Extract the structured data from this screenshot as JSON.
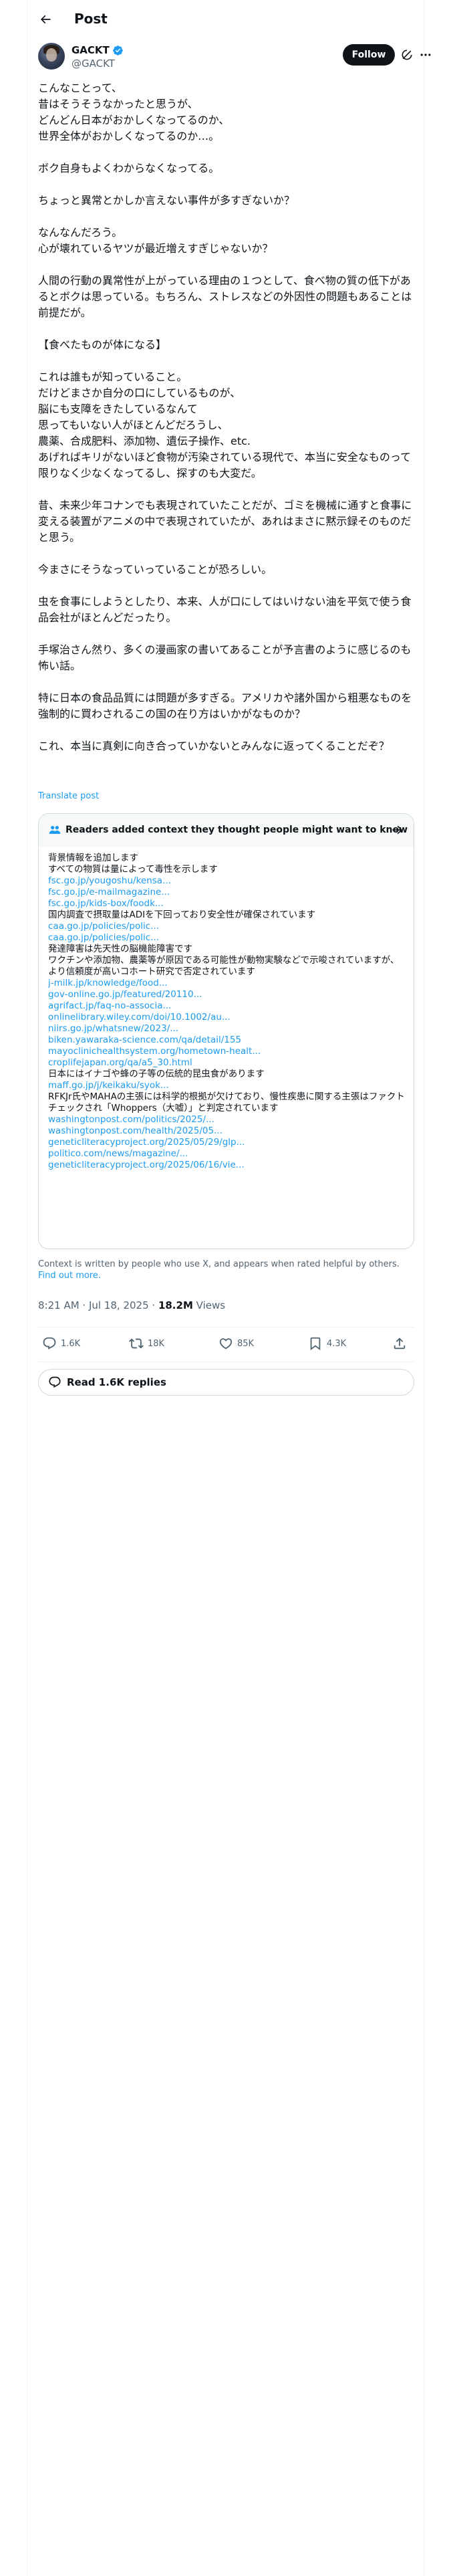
{
  "header": {
    "title": "Post"
  },
  "author": {
    "name": "GACKT",
    "handle": "@GACKT",
    "follow_label": "Follow"
  },
  "tweet": {
    "text": "こんなことって、\n昔はそうそうなかったと思うが、\nどんどん日本がおかしくなってるのか、\n世界全体がおかしくなってるのか…。\n\nボク自身もよくわからなくなってる。\n\nちょっと異常とかしか言えない事件が多すぎないか？\n\nなんなんだろう。\n心が壊れているヤツが最近増えすぎじゃないか？\n\n人間の行動の異常性が上がっている理由の１つとして、食べ物の質の低下があるとボクは思っている。もちろん、ストレスなどの外因性の問題もあることは前提だが。\n\n【食べたものが体になる】\n\nこれは誰もが知っていること。\nだけどまさか自分の口にしているものが、\n脳にも支障をきたしているなんて\n思ってもいない人がほとんどだろうし、\n農薬、合成肥料、添加物、遺伝子操作、etc.\nあげればキリがないほど食物が汚染されている現代で、本当に安全なものって限りなく少なくなってるし、探すのも大変だ。\n\n昔、未来少年コナンでも表現されていたことだが、ゴミを機械に通すと食事に変える装置がアニメの中で表現されていたが、あれはまさに黙示録そのものだと思う。\n\n今まさにそうなっていっていることが恐ろしい。\n\n虫を食事にしようとしたり、本来、人が口にしてはいけない油を平気で使う食品会社がほとんどだったり。\n\n手塚治さん然り、多くの漫画家の書いてあることが予言書のように感じるのも怖い話。\n\n特に日本の食品品質には問題が多すぎる。アメリカや諸外国から粗悪なものを強制的に買わされるこの国の在り方はいかがなものか？\n\nこれ、本当に真剣に向き合っていかないとみんなに返ってくることだぞ？",
    "translate_label": "Translate post"
  },
  "community_note": {
    "title": "Readers added context they thought people might want to know",
    "lines": [
      {
        "text": "背景情報を追加します",
        "link": false
      },
      {
        "text": "すべての物質は量によって毒性を示します",
        "link": false
      },
      {
        "text": "fsc.go.jp/yougoshu/kensa...",
        "link": true
      },
      {
        "text": "fsc.go.jp/e-mailmagazine...",
        "link": true
      },
      {
        "text": "fsc.go.jp/kids-box/foodk...",
        "link": true
      },
      {
        "text": "国内調査で摂取量はADIを下回っており安全性が確保されています",
        "link": false
      },
      {
        "text": "caa.go.jp/policies/polic...",
        "link": true
      },
      {
        "text": "caa.go.jp/policies/polic...",
        "link": true
      },
      {
        "text": "発達障害は先天性の脳機能障害です",
        "link": false
      },
      {
        "text": "ワクチンや添加物、農薬等が原因である可能性が動物実験などで示唆されていますが、より信頼度が高いコホート研究で否定されています",
        "link": false
      },
      {
        "text": "j-milk.jp/knowledge/food...",
        "link": true
      },
      {
        "text": "gov-online.go.jp/featured/20110...",
        "link": true
      },
      {
        "text": "agrifact.jp/faq-no-associa...",
        "link": true
      },
      {
        "text": "onlinelibrary.wiley.com/doi/10.1002/au...",
        "link": true
      },
      {
        "text": "niirs.go.jp/whatsnew/2023/...",
        "link": true
      },
      {
        "text": "biken.yawaraka-science.com/qa/detail/155",
        "link": true
      },
      {
        "text": "mayoclinichealthsystem.org/hometown-healt...",
        "link": true
      },
      {
        "text": "croplifejapan.org/qa/a5_30.html",
        "link": true
      },
      {
        "text": "日本にはイナゴや蜂の子等の伝統的昆虫食があります",
        "link": false
      },
      {
        "text": "maff.go.jp/j/keikaku/syok...",
        "link": true
      },
      {
        "text": "RFKJr氏やMAHAの主張には科学的根拠が欠けており、慢性疾患に関する主張はファクトチェックされ「Whoppers（大嘘）」と判定されています",
        "link": false
      },
      {
        "text": "washingtonpost.com/politics/2025/...",
        "link": true
      },
      {
        "text": "washingtonpost.com/health/2025/05...",
        "link": true
      },
      {
        "text": "geneticliteracyproject.org/2025/05/29/glp...",
        "link": true
      },
      {
        "text": "politico.com/news/magazine/...",
        "link": true
      },
      {
        "text": "geneticliteracyproject.org/2025/06/16/vie...",
        "link": true
      }
    ],
    "footer_text": "Context is written by people who use X, and appears when rated helpful by others.",
    "find_more_label": "Find out more."
  },
  "meta": {
    "time": "8:21 AM · Jul 18, 2025 · ",
    "views_count": "18.2M",
    "views_label": " Views"
  },
  "actions": {
    "replies": "1.6K",
    "reposts": "18K",
    "likes": "85K",
    "bookmarks": "4.3K"
  },
  "read_replies_label": "Read 1.6K replies",
  "icons": {
    "back": "back-arrow-icon",
    "verified": "verified-badge-icon",
    "grok": "grok-icon",
    "more": "more-icon",
    "people": "people-icon",
    "arrow": "arrow-right-icon",
    "reply": "reply-icon",
    "repost": "repost-icon",
    "like": "like-icon",
    "bookmark": "bookmark-icon",
    "share": "share-icon"
  },
  "colors": {
    "accent": "#1d9bf0",
    "text": "#0f1419",
    "secondary": "#536471",
    "border": "#cfd9de"
  }
}
